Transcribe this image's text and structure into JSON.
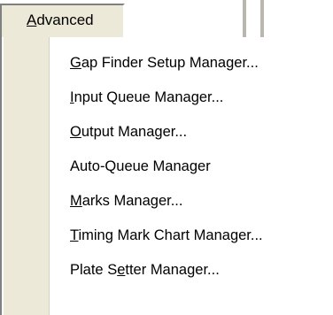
{
  "menubar": {
    "advanced": {
      "pre": "",
      "mnemonic": "A",
      "post": "dvanced"
    }
  },
  "menu": {
    "items": [
      {
        "pre": "",
        "mnemonic": "G",
        "post": "ap Finder Setup Manager..."
      },
      {
        "pre": "",
        "mnemonic": "I",
        "post": "nput Queue Manager..."
      },
      {
        "pre": "",
        "mnemonic": "O",
        "post": "utput Manager..."
      },
      {
        "pre": "Auto-Queue Manager",
        "mnemonic": "",
        "post": ""
      },
      {
        "pre": "",
        "mnemonic": "M",
        "post": "arks Manager..."
      },
      {
        "pre": "",
        "mnemonic": "T",
        "post": "iming Mark Chart Manager..."
      },
      {
        "pre": "Plate S",
        "mnemonic": "e",
        "post": "tter Manager..."
      }
    ]
  }
}
